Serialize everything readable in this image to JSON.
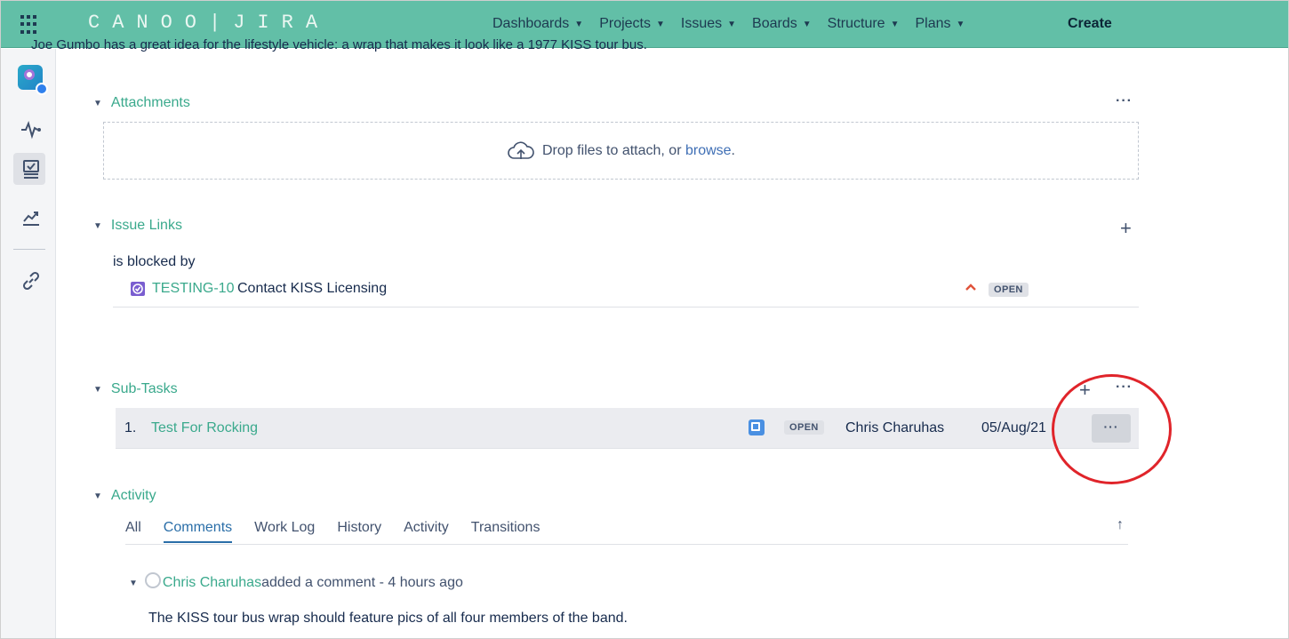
{
  "nav": {
    "brand": "CANOO|JIRA",
    "menu": [
      {
        "label": "Dashboards"
      },
      {
        "label": "Projects"
      },
      {
        "label": "Issues"
      },
      {
        "label": "Boards"
      },
      {
        "label": "Structure"
      },
      {
        "label": "Plans"
      }
    ],
    "create_label": "Create"
  },
  "clipped_description": "Joe Gumbo has a great idea for the lifestyle vehicle: a wrap that makes it look like a 1977 KISS tour bus.",
  "attachments": {
    "heading": "Attachments",
    "drop_text": "Drop files to attach, or ",
    "browse_label": "browse",
    "drop_suffix": "."
  },
  "issue_links": {
    "heading": "Issue Links",
    "relation_label": "is blocked by",
    "items": [
      {
        "key": "TESTING-10",
        "summary": "Contact KISS Licensing",
        "status": "OPEN"
      }
    ]
  },
  "subtasks": {
    "heading": "Sub-Tasks",
    "items": [
      {
        "number": "1.",
        "title": "Test For Rocking",
        "status": "OPEN",
        "assignee": "Chris Charuhas",
        "date": "05/Aug/21"
      }
    ]
  },
  "activity": {
    "heading": "Activity",
    "tabs": [
      {
        "label": "All",
        "active": false
      },
      {
        "label": "Comments",
        "active": true
      },
      {
        "label": "Work Log",
        "active": false
      },
      {
        "label": "History",
        "active": false
      },
      {
        "label": "Activity",
        "active": false
      },
      {
        "label": "Transitions",
        "active": false
      }
    ],
    "comment": {
      "author": "Chris Charuhas",
      "meta": " added a comment - 4 hours ago",
      "body": "The KISS tour bus wrap should feature pics of all four members of the band."
    }
  },
  "colors": {
    "nav_bg": "#62bfa7",
    "link_green": "#3aa98c",
    "annotation_red": "#e0242a"
  }
}
